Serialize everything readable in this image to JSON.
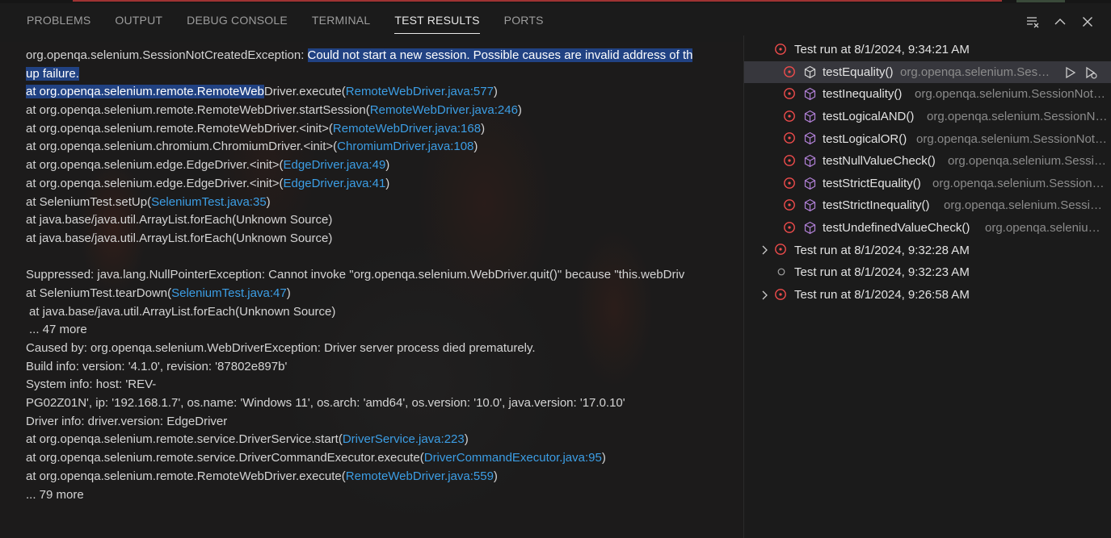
{
  "panel": {
    "tabs": [
      {
        "label": "PROBLEMS"
      },
      {
        "label": "OUTPUT"
      },
      {
        "label": "DEBUG CONSOLE"
      },
      {
        "label": "TERMINAL"
      },
      {
        "label": "TEST RESULTS"
      },
      {
        "label": "PORTS"
      }
    ],
    "active_tab": "TEST RESULTS"
  },
  "log": {
    "l1_pre": "org.openqa.selenium.SessionNotCreatedException: ",
    "l1_sel": "Could not start a new session. Possible causes are invalid address of th",
    "l2_sel": "up failure.",
    "l3_sel": " at org.openqa.selenium.remote.RemoteWeb",
    "l3_rest": "Driver.execute(",
    "l3_link": "RemoteWebDriver.java:577",
    "l4_pre": " at org.openqa.selenium.remote.RemoteWebDriver.startSession(",
    "l4_link": "RemoteWebDriver.java:246",
    "l5_pre": " at org.openqa.selenium.remote.RemoteWebDriver.<init>(",
    "l5_link": "RemoteWebDriver.java:168",
    "l6_pre": " at org.openqa.selenium.chromium.ChromiumDriver.<init>(",
    "l6_link": "ChromiumDriver.java:108",
    "l7_pre": " at org.openqa.selenium.edge.EdgeDriver.<init>(",
    "l7_link": "EdgeDriver.java:49",
    "l8_pre": " at org.openqa.selenium.edge.EdgeDriver.<init>(",
    "l8_link": "EdgeDriver.java:41",
    "l9_pre": " at SeleniumTest.setUp(",
    "l9_link": "SeleniumTest.java:35",
    "l10": " at java.base/java.util.ArrayList.forEach(Unknown Source)",
    "l11": " at java.base/java.util.ArrayList.forEach(Unknown Source)",
    "l12": " Suppressed: java.lang.NullPointerException: Cannot invoke \"org.openqa.selenium.WebDriver.quit()\" because \"this.webDriv",
    "l13_pre": " at SeleniumTest.tearDown(",
    "l13_link": "SeleniumTest.java:47",
    "l14": " at java.base/java.util.ArrayList.forEach(Unknown Source)",
    "l15": " ... 47 more",
    "l16": "Caused by: org.openqa.selenium.WebDriverException: Driver server process died prematurely.",
    "l17": "Build info: version: '4.1.0', revision: '87802e897b'",
    "l18": "System info: host: 'REV-",
    "l19": "PG02Z01N', ip: '192.168.1.7', os.name: 'Windows 11', os.arch: 'amd64', os.version: '10.0', java.version: '17.0.10'",
    "l20": "Driver info: driver.version: EdgeDriver",
    "l21_pre": " at org.openqa.selenium.remote.service.DriverService.start(",
    "l21_link": "DriverService.java:223",
    "l22_pre": " at org.openqa.selenium.remote.service.DriverCommandExecutor.execute(",
    "l22_link": "DriverCommandExecutor.java:95",
    "l23_pre": " at org.openqa.selenium.remote.RemoteWebDriver.execute(",
    "l23_link": "RemoteWebDriver.java:559",
    "l24": " ... 79 more",
    "close_paren": ")"
  },
  "tests": {
    "run1": {
      "label": "Test run at 8/1/2024, 9:34:21 AM"
    },
    "items": [
      {
        "name": "testEquality()",
        "msg": "org.openqa.selenium.Sessi..."
      },
      {
        "name": "testInequality()",
        "msg": "org.openqa.selenium.SessionNotCr..."
      },
      {
        "name": "testLogicalAND()",
        "msg": "org.openqa.selenium.SessionNot..."
      },
      {
        "name": "testLogicalOR()",
        "msg": "org.openqa.selenium.SessionNotCr..."
      },
      {
        "name": "testNullValueCheck()",
        "msg": "org.openqa.selenium.Session..."
      },
      {
        "name": "testStrictEquality()",
        "msg": "org.openqa.selenium.SessionNo..."
      },
      {
        "name": "testStrictInequality()",
        "msg": "org.openqa.selenium.Session..."
      },
      {
        "name": "testUndefinedValueCheck()",
        "msg": "org.openqa.selenium...."
      }
    ],
    "run2": {
      "label": "Test run at 8/1/2024, 9:32:28 AM"
    },
    "run3": {
      "label": "Test run at 8/1/2024, 9:32:23 AM"
    },
    "run4": {
      "label": "Test run at 8/1/2024, 9:26:58 AM"
    }
  },
  "colors": {
    "error": "#f14c4c",
    "cube": "#b180d7",
    "link": "#3c9ee5",
    "selection": "#214283"
  },
  "icons": {
    "header": [
      "clear-all-icon",
      "chevron-up-icon",
      "close-icon"
    ],
    "status": [
      "error-circle-icon",
      "unset-circle-icon"
    ],
    "test": "cube-icon",
    "actions": [
      "run-icon",
      "debug-icon"
    ]
  }
}
